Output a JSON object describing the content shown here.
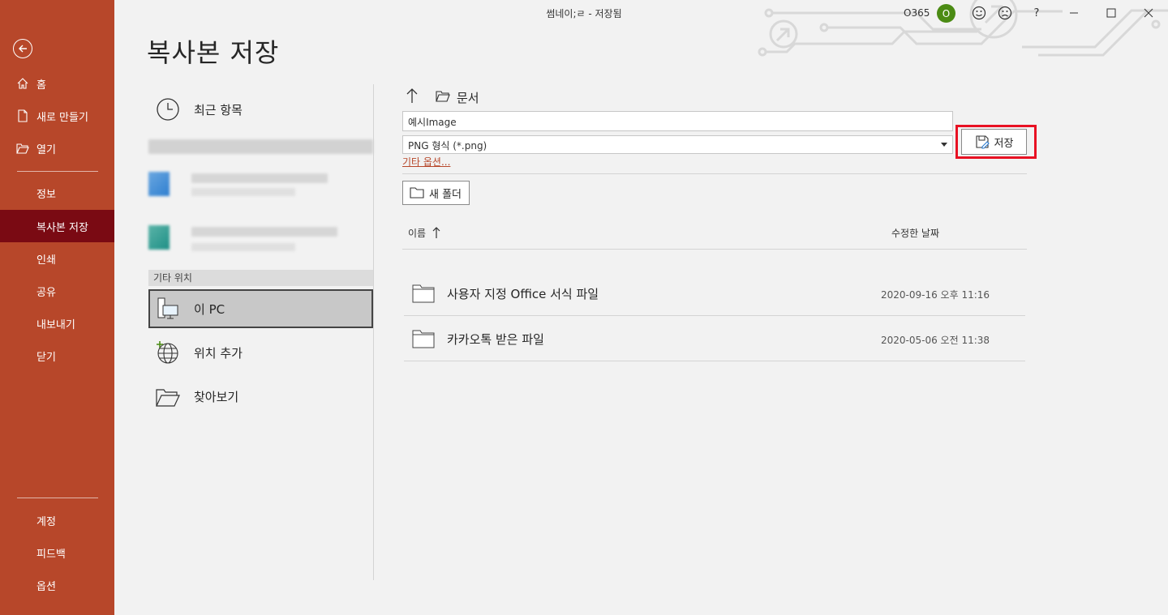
{
  "window": {
    "title": "썸네이;ㄹ - 저장됨",
    "account_label": "O365",
    "avatar_initial": "O",
    "help_label": "?"
  },
  "sidebar": {
    "items": [
      {
        "label": "홈",
        "icon": "home-icon"
      },
      {
        "label": "새로 만들기",
        "icon": "new-document-icon"
      },
      {
        "label": "열기",
        "icon": "open-folder-icon"
      },
      {
        "label": "정보"
      },
      {
        "label": "복사본 저장",
        "active": true
      },
      {
        "label": "인쇄"
      },
      {
        "label": "공유"
      },
      {
        "label": "내보내기"
      },
      {
        "label": "닫기"
      }
    ],
    "bottom_items": [
      {
        "label": "계정"
      },
      {
        "label": "피드백"
      },
      {
        "label": "옵션"
      }
    ]
  },
  "page": {
    "title": "복사본 저장"
  },
  "locations": {
    "recent_label": "최근 항목",
    "other_locations_header": "기타 위치",
    "this_pc_label": "이 PC",
    "add_place_label": "위치 추가",
    "browse_label": "찾아보기"
  },
  "save_panel": {
    "current_folder": "문서",
    "filename_value": "예시Image",
    "filetype_value": "PNG 형식 (*.png)",
    "more_options_label": "기타 옵션...",
    "save_button_label": "저장",
    "new_folder_label": "새 폴더",
    "columns": {
      "name": "이름",
      "modified": "수정한 날짜"
    },
    "files": [
      {
        "name": "사용자 지정 Office 서식 파일",
        "modified": "2020-09-16 오후 11:16"
      },
      {
        "name": "카카오톡 받은 파일",
        "modified": "2020-05-06 오전 11:38"
      }
    ]
  },
  "colors": {
    "sidebar_bg": "#b7472a",
    "sidebar_active_bg": "#7a0a13",
    "highlight_border": "#e81123",
    "avatar_bg": "#4b8b14"
  }
}
